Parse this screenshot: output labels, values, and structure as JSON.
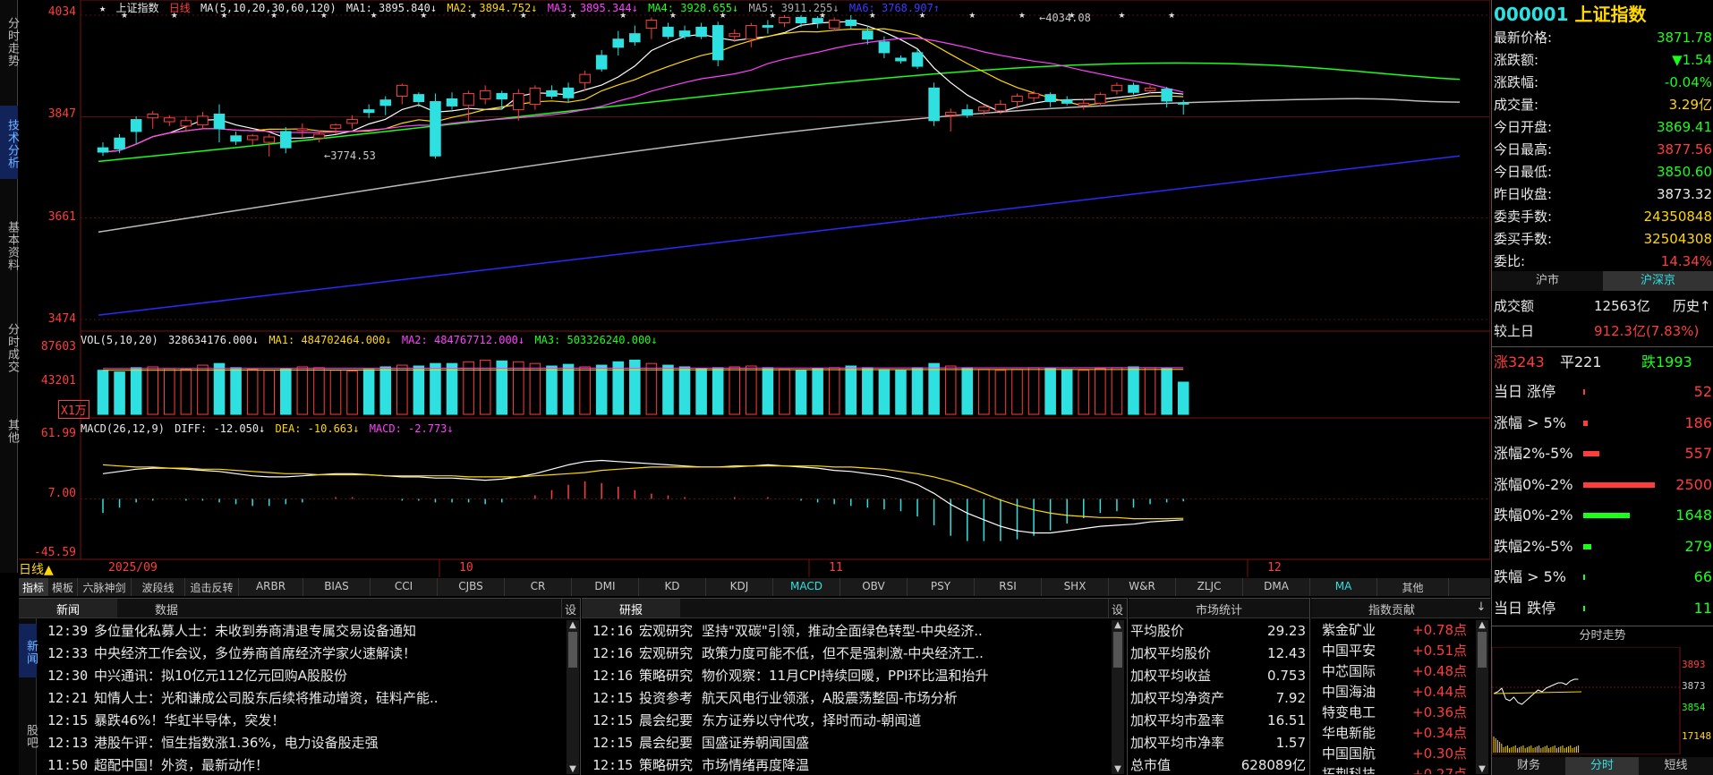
{
  "left_tabs": [
    "分时走势",
    "技术分析",
    "基本资料",
    "分时成交",
    "其他"
  ],
  "price_axis": [
    "4034",
    "3847",
    "3661",
    "3474"
  ],
  "vol_axis": [
    "87603",
    "43201"
  ],
  "vol_unit": "X1万",
  "macd_axis": [
    "61.99",
    "7.00",
    "-45.59"
  ],
  "legend_main": {
    "star": "★",
    "name": "上证指数",
    "period": "日线",
    "ma": "MA(5,10,20,30,60,120)",
    "ma1": "MA1: 3895.840↓",
    "ma2": "MA2: 3894.752↓",
    "ma3": "MA3: 3895.344↓",
    "ma4": "MA4: 3928.655↓",
    "ma5": "MA5: 3911.255↓",
    "ma6": "MA6: 3768.907↑"
  },
  "legend_vol": {
    "name": "VOL(5,10,20)",
    "val": "328634176.000↓",
    "ma1": "MA1: 484702464.000↓",
    "ma2": "MA2: 484767712.000↓",
    "ma3": "MA3: 503326240.000↓"
  },
  "legend_macd": {
    "name": "MACD(26,12,9)",
    "diff": "DIFF: -12.050↓",
    "dea": "DEA: -10.663↓",
    "macd": "MACD: -2.773↓"
  },
  "annotations": {
    "high": "4034.08",
    "low": "3774.53"
  },
  "date_axis": {
    "period": "日线▲",
    "labels": [
      "2025/09",
      "10",
      "11",
      "12"
    ]
  },
  "indicator_tabs": [
    "指标",
    "模板",
    "六脉神剑",
    "波段线",
    "追击反转",
    "ARBR",
    "BIAS",
    "CCI",
    "CJBS",
    "CR",
    "DMI",
    "KD",
    "KDJ",
    "MACD",
    "OBV",
    "PSY",
    "RSI",
    "SHX",
    "W&R",
    "ZLJC",
    "DMA",
    "MA",
    "其他"
  ],
  "news_panel": {
    "tabs": [
      "新闻",
      "数据"
    ],
    "set": "设",
    "side_tabs": [
      "新闻",
      "股吧"
    ],
    "items": [
      {
        "time": "12:39",
        "title": "多位量化私募人士：未收到券商清退专属交易设备通知"
      },
      {
        "time": "12:33",
        "title": "中央经济工作会议，多位券商首席经济学家火速解读！"
      },
      {
        "time": "12:30",
        "title": "中兴通讯：拟10亿元112亿元回购A股股份"
      },
      {
        "time": "12:21",
        "title": "知情人士：光和谦成公司股东后续将推动增资，硅料产能.."
      },
      {
        "time": "12:15",
        "title": "暴跌46%！华虹半导体，突发！"
      },
      {
        "time": "12:13",
        "title": "港股午评：恒生指数涨1.36%，电力设备股走强"
      },
      {
        "time": "11:50",
        "title": "超配中国！外资，最新动作！"
      }
    ]
  },
  "research_panel": {
    "tab": "研报",
    "set": "设",
    "items": [
      {
        "time": "12:16",
        "cat": "宏观研究",
        "title": "坚持\"双碳\"引领，推动全面绿色转型-中央经济.."
      },
      {
        "time": "12:16",
        "cat": "宏观研究",
        "title": "政策力度可能不低，但不是强刺激-中央经济工.."
      },
      {
        "time": "12:16",
        "cat": "策略研究",
        "title": "物价观察：11月CPI持续回暖，PPI环比温和抬升"
      },
      {
        "time": "12:15",
        "cat": "投资参考",
        "title": "航天风电行业领涨，A股震荡整固-市场分析"
      },
      {
        "time": "12:15",
        "cat": "晨会纪要",
        "title": "东方证券以守代攻，择时而动-朝闻道"
      },
      {
        "time": "12:15",
        "cat": "晨会纪要",
        "title": "国盛证券朝闻国盛"
      },
      {
        "time": "12:15",
        "cat": "策略研究",
        "title": "市场情绪再度降温"
      }
    ]
  },
  "stats_panel": {
    "title": "市场统计",
    "rows": [
      {
        "k": "平均股价",
        "v": "29.23"
      },
      {
        "k": "加权平均股价",
        "v": "12.43"
      },
      {
        "k": "加权平均收益",
        "v": "0.753"
      },
      {
        "k": "加权平均净资产",
        "v": "7.92"
      },
      {
        "k": "加权平均市盈率",
        "v": "16.51"
      },
      {
        "k": "加权平均市净率",
        "v": "1.57"
      },
      {
        "k": "总市值",
        "v": "628089亿"
      }
    ]
  },
  "contrib_panel": {
    "title": "指数贡献",
    "arrow": "↓",
    "rows": [
      {
        "k": "紫金矿业",
        "v": "+0.78点"
      },
      {
        "k": "中国平安",
        "v": "+0.51点"
      },
      {
        "k": "中芯国际",
        "v": "+0.48点"
      },
      {
        "k": "中国海油",
        "v": "+0.44点"
      },
      {
        "k": "特变电工",
        "v": "+0.36点"
      },
      {
        "k": "华电新能",
        "v": "+0.34点"
      },
      {
        "k": "中国国航",
        "v": "+0.30点"
      },
      {
        "k": "拓荆科技",
        "v": "+0.27点"
      }
    ]
  },
  "quote": {
    "code": "000001",
    "name": "上证指数",
    "rows": [
      {
        "k": "最新价格:",
        "v": "3871.78",
        "c": "green"
      },
      {
        "k": "涨跌额:",
        "v": "▼1.54",
        "c": "green"
      },
      {
        "k": "涨跌幅:",
        "v": "-0.04%",
        "c": "green"
      },
      {
        "k": "成交量:",
        "v": "3.29亿",
        "c": "yellow"
      },
      {
        "k": "今日开盘:",
        "v": "3869.41",
        "c": "green"
      },
      {
        "k": "今日最高:",
        "v": "3877.56",
        "c": "red"
      },
      {
        "k": "今日最低:",
        "v": "3850.60",
        "c": "green"
      },
      {
        "k": "昨日收盘:",
        "v": "3873.32",
        "c": "white"
      },
      {
        "k": "委卖手数:",
        "v": "24350848",
        "c": "yellow"
      },
      {
        "k": "委买手数:",
        "v": "32504308",
        "c": "yellow"
      },
      {
        "k": "委比:",
        "v": "14.34%",
        "c": "red"
      }
    ],
    "market_tabs": [
      "沪市",
      "沪深京"
    ],
    "turnover_label": "成交额",
    "turnover_value": "12563亿",
    "history_label": "历史↑",
    "prev_label": "较上日",
    "prev_value": "912.3亿(7.83%)",
    "up": "涨3243",
    "flat": "平221",
    "down": "跌1993",
    "dist": [
      {
        "k": "当日 涨停",
        "v": "52",
        "c": "red",
        "w": 2
      },
      {
        "k": "涨幅 > 5%",
        "v": "186",
        "c": "red",
        "w": 5
      },
      {
        "k": "涨幅2%-5%",
        "v": "557",
        "c": "red",
        "w": 18
      },
      {
        "k": "涨幅0%-2%",
        "v": "2500",
        "c": "red",
        "w": 80
      },
      {
        "k": "跌幅0%-2%",
        "v": "1648",
        "c": "green",
        "w": 52
      },
      {
        "k": "跌幅2%-5%",
        "v": "279",
        "c": "green",
        "w": 9
      },
      {
        "k": "跌幅 > 5%",
        "v": "66",
        "c": "green",
        "w": 2
      },
      {
        "k": "当日 跌停",
        "v": "11",
        "c": "green",
        "w": 0
      }
    ],
    "mini_title": "分时走势",
    "mini_axis": [
      "3893",
      "3873",
      "3854",
      "17148"
    ],
    "bottom_tabs": [
      "财务",
      "分时",
      "短线"
    ]
  },
  "chart_data": {
    "type": "candlestick",
    "title": "上证指数 日线",
    "price_range": [
      3474,
      4034
    ],
    "candles": [
      [
        3790,
        3782,
        3800,
        3775
      ],
      [
        3808,
        3788,
        3815,
        3780
      ],
      [
        3842,
        3820,
        3848,
        3798
      ],
      [
        3845,
        3852,
        3858,
        3825
      ],
      [
        3838,
        3845,
        3850,
        3830
      ],
      [
        3830,
        3840,
        3848,
        3820
      ],
      [
        3832,
        3848,
        3856,
        3825
      ],
      [
        3852,
        3825,
        3870,
        3800
      ],
      [
        3812,
        3802,
        3820,
        3795
      ],
      [
        3805,
        3812,
        3815,
        3795
      ],
      [
        3800,
        3810,
        3815,
        3774
      ],
      [
        3820,
        3790,
        3828,
        3780
      ],
      [
        3822,
        3825,
        3835,
        3808
      ],
      [
        3808,
        3815,
        3822,
        3800
      ],
      [
        3826,
        3832,
        3835,
        3815
      ],
      [
        3835,
        3842,
        3850,
        3825
      ],
      [
        3860,
        3855,
        3870,
        3845
      ],
      [
        3878,
        3868,
        3885,
        3850
      ],
      [
        3885,
        3905,
        3908,
        3870
      ],
      [
        3888,
        3875,
        3892,
        3865
      ],
      [
        3875,
        3775,
        3890,
        3770
      ],
      [
        3880,
        3867,
        3892,
        3860
      ],
      [
        3868,
        3890,
        3895,
        3838
      ],
      [
        3880,
        3895,
        3905,
        3870
      ],
      [
        3890,
        3880,
        3895,
        3860
      ],
      [
        3860,
        3890,
        3898,
        3840
      ],
      [
        3870,
        3900,
        3905,
        3860
      ],
      [
        3895,
        3885,
        3905,
        3880
      ],
      [
        3900,
        3882,
        3910,
        3875
      ],
      [
        3910,
        3925,
        3932,
        3895
      ],
      [
        3960,
        3935,
        3970,
        3930
      ],
      [
        3990,
        3975,
        4005,
        3960
      ],
      [
        4000,
        3985,
        4015,
        3978
      ],
      [
        4010,
        4025,
        4030,
        3990
      ],
      [
        4012,
        3995,
        4020,
        3990
      ],
      [
        4005,
        3995,
        4015,
        3990
      ],
      [
        4012,
        3995,
        4020,
        3990
      ],
      [
        4015,
        3952,
        4022,
        3940
      ],
      [
        3995,
        4000,
        4008,
        3985
      ],
      [
        3990,
        4015,
        4020,
        3975
      ],
      [
        4015,
        4012,
        4025,
        4000
      ],
      [
        4020,
        4030,
        4034,
        4012
      ],
      [
        4030,
        4020,
        4034,
        4012
      ],
      [
        4028,
        4020,
        4032,
        4010
      ],
      [
        4010,
        4025,
        4030,
        4005
      ],
      [
        4025,
        4015,
        4034,
        4008
      ],
      [
        4005,
        3990,
        4015,
        3980
      ],
      [
        3985,
        3965,
        3995,
        3955
      ],
      [
        3955,
        3950,
        3960,
        3945
      ],
      [
        3965,
        3940,
        3972,
        3935
      ],
      [
        3900,
        3840,
        3910,
        3830
      ],
      [
        3850,
        3855,
        3862,
        3820
      ],
      [
        3860,
        3850,
        3870,
        3845
      ],
      [
        3858,
        3865,
        3870,
        3850
      ],
      [
        3858,
        3870,
        3878,
        3852
      ],
      [
        3875,
        3885,
        3890,
        3862
      ],
      [
        3882,
        3890,
        3895,
        3875
      ],
      [
        3888,
        3875,
        3892,
        3865
      ],
      [
        3878,
        3872,
        3885,
        3868
      ],
      [
        3868,
        3872,
        3880,
        3860
      ],
      [
        3872,
        3888,
        3892,
        3866
      ],
      [
        3895,
        3905,
        3910,
        3888
      ],
      [
        3905,
        3892,
        3910,
        3888
      ],
      [
        3895,
        3900,
        3905,
        3890
      ],
      [
        3898,
        3876,
        3902,
        3864
      ],
      [
        3872,
        3871,
        3878,
        3851
      ]
    ],
    "volume_range": [
      0,
      87603
    ],
    "volume": [
      52,
      50,
      55,
      56,
      54,
      53,
      58,
      60,
      55,
      53,
      52,
      54,
      56,
      55,
      52,
      51,
      53,
      56,
      58,
      57,
      60,
      60,
      62,
      64,
      63,
      62,
      60,
      57,
      59,
      56,
      58,
      62,
      64,
      60,
      58,
      56,
      54,
      55,
      56,
      57,
      55,
      53,
      52,
      54,
      55,
      57,
      55,
      53,
      52,
      55,
      60,
      57,
      55,
      53,
      52,
      53,
      55,
      54,
      53,
      52,
      54,
      55,
      56,
      55,
      54,
      38
    ],
    "macd_range": [
      -45.59,
      61.99
    ],
    "macd_diff": [
      30,
      32,
      34,
      35,
      35,
      34,
      33,
      32,
      30,
      28,
      27,
      27,
      28,
      29,
      30,
      30,
      29,
      28,
      27,
      27,
      26,
      26,
      25,
      24,
      25,
      27,
      30,
      34,
      38,
      41,
      42,
      41,
      40,
      39,
      38,
      37,
      36,
      36,
      37,
      37,
      38,
      37,
      36,
      35,
      33,
      32,
      30,
      28,
      25,
      20,
      12,
      2,
      -6,
      -12,
      -18,
      -22,
      -24,
      -24,
      -22,
      -20,
      -18,
      -17,
      -16,
      -14,
      -13,
      -12
    ],
    "macd_dea": [
      38,
      37,
      36,
      36,
      35,
      35,
      34,
      34,
      33,
      32,
      31,
      30,
      30,
      29,
      29,
      29,
      29,
      28,
      28,
      28,
      28,
      28,
      27,
      27,
      27,
      27,
      28,
      29,
      30,
      31,
      33,
      34,
      35,
      36,
      36,
      36,
      36,
      36,
      36,
      37,
      37,
      37,
      37,
      37,
      36,
      36,
      35,
      34,
      32,
      30,
      27,
      23,
      18,
      12,
      6,
      1,
      -3,
      -6,
      -8,
      -9,
      -10,
      -10,
      -11,
      -11,
      -11,
      -10.7
    ],
    "macd_bar": [
      -16,
      -10,
      -4,
      -2,
      0,
      -2,
      -2,
      -4,
      -6,
      -8,
      -8,
      -6,
      -4,
      0,
      2,
      2,
      0,
      0,
      -2,
      -2,
      -4,
      -4,
      -4,
      -6,
      -4,
      0,
      4,
      10,
      16,
      20,
      18,
      14,
      10,
      6,
      4,
      2,
      0,
      0,
      2,
      0,
      2,
      0,
      -2,
      -4,
      -6,
      -8,
      -10,
      -12,
      -14,
      -20,
      -30,
      -42,
      -48,
      -48,
      -48,
      -46,
      -42,
      -36,
      -28,
      -22,
      -16,
      -14,
      -10,
      -6,
      -4,
      -2.8
    ]
  }
}
